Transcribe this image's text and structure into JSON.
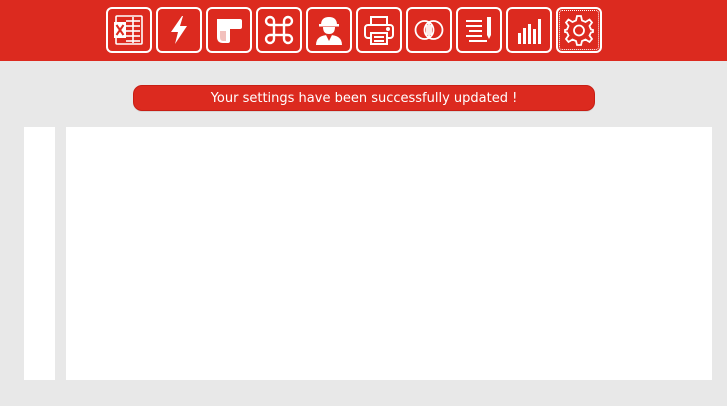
{
  "toolbar": {
    "items": [
      {
        "icon": "excel-icon"
      },
      {
        "icon": "lightning-icon"
      },
      {
        "icon": "shape-icon"
      },
      {
        "icon": "command-icon"
      },
      {
        "icon": "worker-icon"
      },
      {
        "icon": "printer-icon"
      },
      {
        "icon": "overlap-circles-icon"
      },
      {
        "icon": "edit-list-icon"
      },
      {
        "icon": "bar-chart-icon"
      },
      {
        "icon": "gear-icon"
      }
    ],
    "active_icon": "gear-icon"
  },
  "notification": {
    "message": "Your settings have been successfully updated !"
  },
  "colors": {
    "brand_red": "#dc2a1f",
    "background": "#e8e8e8",
    "panel": "#ffffff"
  }
}
